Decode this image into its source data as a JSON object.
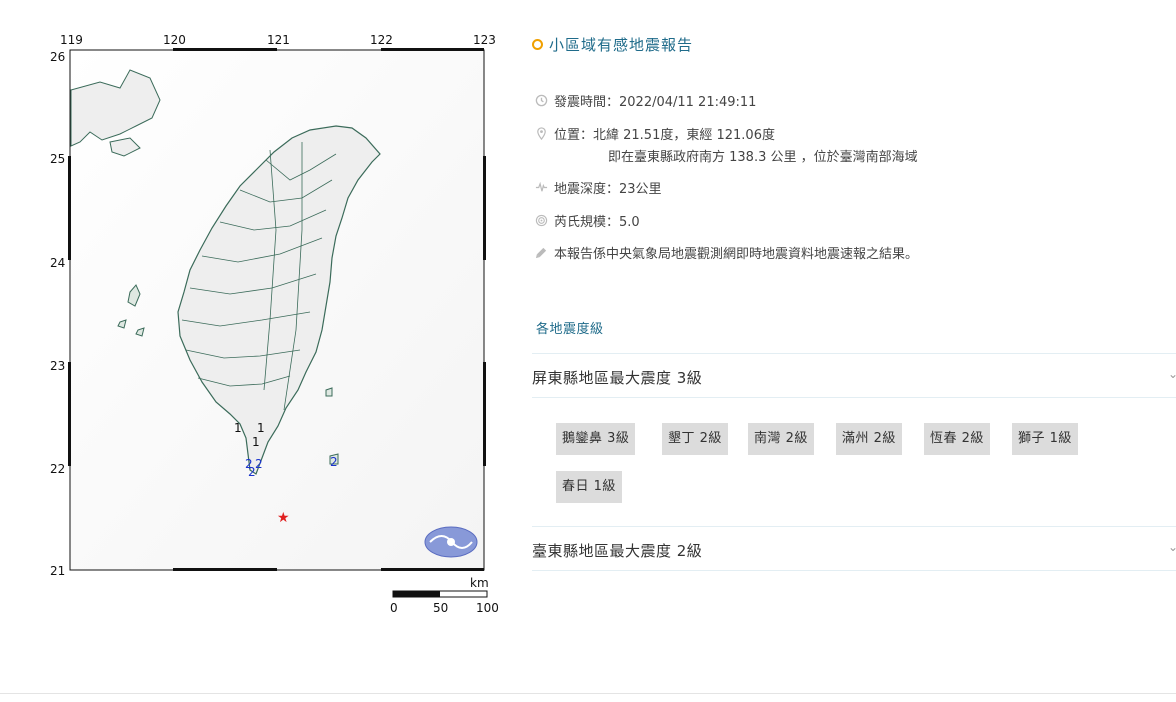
{
  "map": {
    "lon_labels": [
      "119",
      "120",
      "121",
      "122",
      "123"
    ],
    "lat_labels": [
      "26",
      "25",
      "24",
      "23",
      "22",
      "21"
    ],
    "scale_unit": "km",
    "scale_labels": [
      "0",
      "50",
      "100"
    ],
    "station_labels": [
      "1",
      "1",
      "1",
      "2",
      "2",
      "2",
      "2"
    ],
    "epicenter_marker": "★",
    "colors": {
      "sea": "#ffffff",
      "land": "#eeeeee",
      "border": "#3b6b5a",
      "epicenter": "#e02020",
      "station": "#1a33cc"
    }
  },
  "report": {
    "title": "小區域有感地震報告",
    "time_label": "發震時間：2022/04/11 21:49:11",
    "location_line1": "位置：北緯 21.51度，東經 121.06度",
    "location_line2": "即在臺東縣政府南方 138.3 公里 ，位於臺灣南部海域",
    "depth_label": "地震深度：23公里",
    "magnitude_label": "芮氏規模：5.0",
    "note": "本報告係中央氣象局地震觀測網即時地震資料地震速報之結果。",
    "icons": [
      "clock-icon",
      "location-pin-icon",
      "depth-wave-icon",
      "magnitude-ring-icon",
      "announcement-icon"
    ]
  },
  "intensity": {
    "section_title": "各地震度級",
    "groups": [
      {
        "title": "屏東縣地區最大震度 3級",
        "stations": [
          "鵝鑾鼻 3級",
          "墾丁 2級",
          "南灣 2級",
          "滿州 2級",
          "恆春 2級",
          "獅子 1級",
          "春日 1級"
        ]
      },
      {
        "title": "臺東縣地區最大震度 2級",
        "stations": []
      }
    ]
  }
}
